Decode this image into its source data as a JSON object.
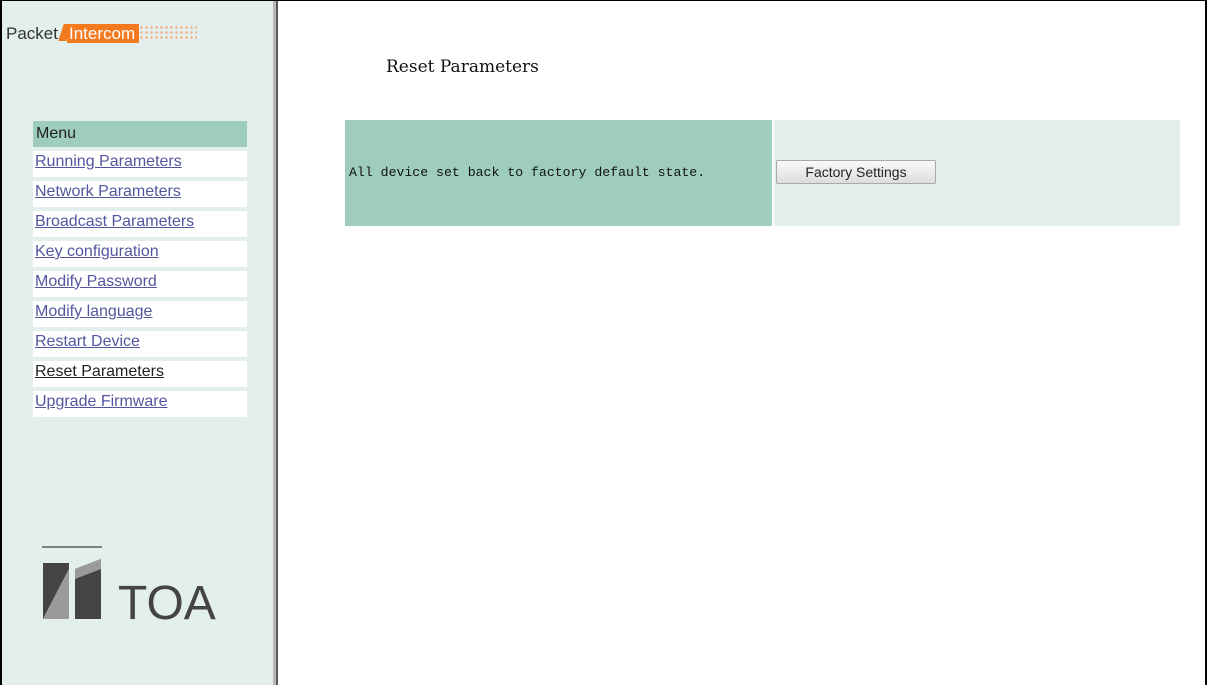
{
  "brand": {
    "part1": "Packet",
    "part2": "Intercom"
  },
  "sidebar": {
    "menu_header": "Menu",
    "items": [
      {
        "label": "Running Parameters",
        "active": false
      },
      {
        "label": "Network Parameters",
        "active": false
      },
      {
        "label": "Broadcast Parameters",
        "active": false
      },
      {
        "label": "Key configuration",
        "active": false
      },
      {
        "label": "Modify Password",
        "active": false
      },
      {
        "label": "Modify language",
        "active": false
      },
      {
        "label": "Restart Device",
        "active": false
      },
      {
        "label": "Reset Parameters",
        "active": true
      },
      {
        "label": "Upgrade Firmware",
        "active": false
      }
    ],
    "logo_text": "TOA"
  },
  "main": {
    "title": "Reset Parameters",
    "reset_row": {
      "label": "All device set back to factory default state.",
      "button_label": "Factory Settings"
    }
  },
  "colors": {
    "sidebar_bg": "#e2efec",
    "menu_header_bg": "#9ecdbd",
    "link": "#53569e",
    "brand_orange": "#f47a20"
  }
}
